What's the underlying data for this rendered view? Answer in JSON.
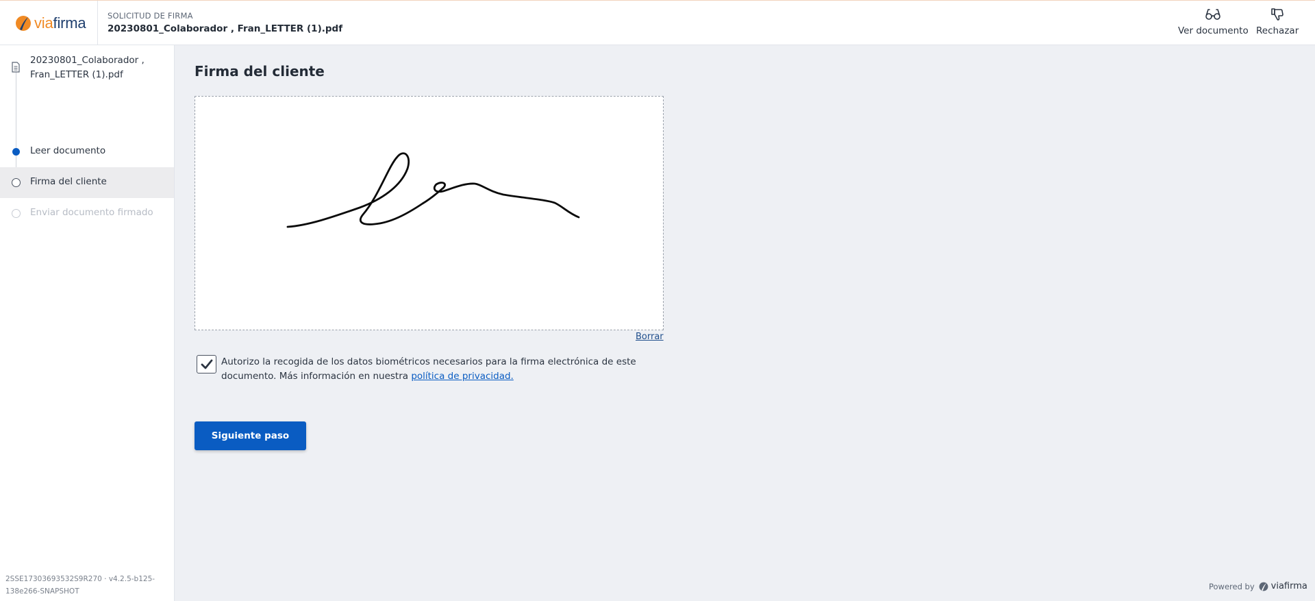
{
  "header": {
    "brand": "viafirma",
    "brand_prefix": "via",
    "brand_suffix": "firma",
    "request_label": "SOLICITUD DE FIRMA",
    "document_title": "20230801_Colaborador , Fran_LETTER (1).pdf",
    "actions": [
      {
        "label": "Ver documento",
        "icon": "glasses-icon"
      },
      {
        "label": "Rechazar",
        "icon": "thumbs-down-icon"
      }
    ]
  },
  "sidebar": {
    "document_name": "20230801_Colaborador , Fran_LETTER (1).pdf",
    "steps": [
      {
        "label": "Leer documento",
        "state": "completed"
      },
      {
        "label": "Firma del cliente",
        "state": "current"
      },
      {
        "label": "Enviar documento firmado",
        "state": "pending"
      }
    ],
    "version": "2SSE17303693532S9R270 · v4.2.5-b125-138e266-SNAPSHOT"
  },
  "main": {
    "title": "Firma del cliente",
    "clear_label": "Borrar",
    "consent_checked": true,
    "consent_text": "Autorizo la recogida de los datos biométricos necesarios para la firma electrónica de este documento. Más información en nuestra ",
    "privacy_link": "política de privacidad.",
    "next_button": "Siguiente paso"
  },
  "footer": {
    "powered_by": "Powered by",
    "brand": "viafirma"
  },
  "colors": {
    "primary": "#0a5cc2",
    "brand_orange": "#f08a24",
    "brand_navy": "#1f3f6e",
    "background": "#eef0f4"
  }
}
